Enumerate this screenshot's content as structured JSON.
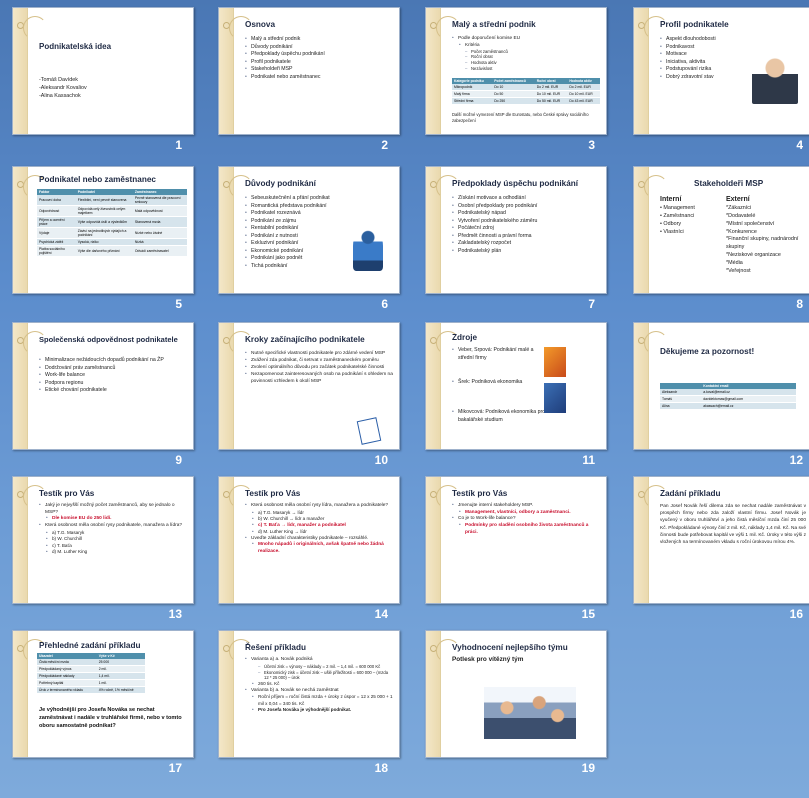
{
  "slides": [
    {
      "num": "1",
      "title": "Podnikatelská idea",
      "authors": [
        "-Tomáš Davídek",
        "-Aleksandr Kovaliov",
        "-Alina Kassachok"
      ]
    },
    {
      "num": "2",
      "title": "Osnova",
      "bullets": [
        "Malý a střední podnik",
        "Důvody podnikání",
        "Předpoklady úspěchu podnikání",
        "Profil podnikatele",
        "Stakeholdeři MSP",
        "Podnikatel nebo zaměstnanec"
      ]
    },
    {
      "num": "3",
      "title": "Malý a střední podnik",
      "bullet1": "Podle doporučení komise EU",
      "sub1": "Kritéria",
      "sub2": [
        "Počet zaměstnanců",
        "Roční obrat",
        "Hodnota aktiv",
        "Nezávislost"
      ],
      "table": {
        "head": [
          "Kategorie podniku",
          "Počet zaměstnanců",
          "Roční obrat",
          "Hodnota aktiv"
        ],
        "rows": [
          [
            "Mikropodnik",
            "Do 10",
            "Do 2 mil. EUR",
            "Do 2 mil. EUR"
          ],
          [
            "Malý firma",
            "Do 50",
            "Do 10 mil. EUR",
            "Do 10 mil. EUR"
          ],
          [
            "Střední firma",
            "Do 250",
            "Do 50 mil. EUR",
            "Do 43 mil. EUR"
          ]
        ]
      },
      "note": "Další možné vymezení MSP dle Eurostatu, nebo České správy sociálního zabezpečení"
    },
    {
      "num": "4",
      "title": "Profil podnikatele",
      "bullets": [
        "Aspekt dlouhodobosti",
        "Podnikavost",
        "Motivace",
        "Iniciativa, aktivita",
        "Podstupování rizika",
        "Dobrý zdravotní stav"
      ]
    },
    {
      "num": "5",
      "title": "Podnikatel nebo zaměstnanec",
      "table": {
        "head": [
          "Faktor",
          "Podnikatel",
          "Zaměstnanec"
        ],
        "rows": [
          [
            "Pracovní doba",
            "Flexibilní, není pevně stanovena",
            "Pevně stanovená dle pracovní smlouvy"
          ],
          [
            "Odpovědnost",
            "Odpovídá celý živnostník celým majetkem",
            "Malá odpovědnost"
          ],
          [
            "Příjem a ocenění práce",
            "Výše odpovídá úsilí a výsledkům",
            "Stanovená mzda"
          ],
          [
            "Výdaje",
            "Závisí na jednotlivých výdajích a podnikání",
            "Nízké nebo žádné"
          ],
          [
            "Psychická zátěž",
            "Vysoká, riziko",
            "Nízká"
          ],
          [
            "Platba sociálního pojištění",
            "Výše dle daňového přiznání",
            "Odvádí zaměstnavatel"
          ]
        ]
      }
    },
    {
      "num": "6",
      "title": "Důvody podnikání",
      "bullets": [
        "Sebeuskutečnění a přání podnikat",
        "Romantická představa podnikání",
        "Podnikatel rozeznává",
        "Podnikání ze zájmu",
        "Rentabilní podnikání",
        "Podnikání z nutnosti",
        "Exkluzivní podnikání",
        "Ekonomické podnikání",
        "Podnikání jako podnět",
        "Tichá podnikání"
      ]
    },
    {
      "num": "7",
      "title": "Předpoklady úspěchu podnikání",
      "bullets": [
        "Získání motivace a odhodlání",
        "Osobní předpoklady pro podnikání",
        "Podnikatelský nápad",
        "Vytvoření podnikatelského záměru",
        "Počáteční zdroj",
        "Předmět činnosti a právní forma",
        "Zakladatelský rozpočet",
        "Podnikatelský plán"
      ]
    },
    {
      "num": "8",
      "title": "Stakeholdeři MSP",
      "internal_h": "Interní",
      "internal": [
        "Management",
        "Zaměstnanci",
        "Odbory",
        "Vlastníci"
      ],
      "external_h": "Externí",
      "external": [
        "Zákazníci",
        "Dodavatelé",
        "Místní společenství",
        "Konkurence",
        "Finanční skupiny, nadnárodní skupiny",
        "Neziskové organizace",
        "Média",
        "Veřejnost"
      ]
    },
    {
      "num": "9",
      "title": "Společenská odpovědnost podnikatele",
      "bullets": [
        "Minimalizace nežádoucích dopadů podnikání na ŽP",
        "Dodržování práv zaměstnanců",
        "Work-life balance",
        "Podpora regionu",
        "Etické chování podnikatele"
      ]
    },
    {
      "num": "10",
      "title": "Kroky začínajícího podnikatele",
      "bullets": [
        "Nutné specifické vlastnosti podnikatele pro zdárné vedení MSP",
        "Zvážení zda podnikat, či setrvat v zaměstnaneckém poměru",
        "Zvolení optimálního důvodu pro začátek podnikatelské činnosti",
        "Nezapomenout zainteresovaných osob na podnikání s ohledem na povinnosti vzhledem k okolí MSP"
      ]
    },
    {
      "num": "11",
      "title": "Zdroje",
      "bullets": [
        "Veber, Srpová: Podnikání malé a střední firmy",
        "Šrek: Podniková ekonomika",
        "Mikovcová: Podniková ekonomika pro bakalářské studium"
      ]
    },
    {
      "num": "12",
      "title": "Děkujeme za pozornost!",
      "table": {
        "head": [
          "",
          "Kontaktní email"
        ],
        "rows": [
          [
            "Aleksandr",
            "a.koval@email.cz"
          ],
          [
            "Tomáš",
            "davidektomas@gmail.com"
          ],
          [
            "Alina",
            "akassach@email.cz"
          ]
        ]
      }
    },
    {
      "num": "13",
      "title": "Testík pro Vás",
      "items": [
        {
          "t": "b",
          "v": "Jaký je nejvyšší možný počet zaměstnanců, aby se jednalo o MSP?"
        },
        {
          "t": "red",
          "v": "Dle komise EU do 250 lidí."
        },
        {
          "t": "b",
          "v": "Která osobnost měla osobní rysy podnikatele, manažera a lídra?"
        },
        {
          "t": "sub",
          "v": "a) T.G. Masaryk"
        },
        {
          "t": "sub",
          "v": "b) W. Churchill"
        },
        {
          "t": "sub",
          "v": "c) T. Baťa"
        },
        {
          "t": "sub",
          "v": "d) M. Luther King"
        }
      ]
    },
    {
      "num": "14",
      "title": "Testík pro Vás",
      "items": [
        {
          "t": "b",
          "v": "Která osobnost měla osobní rysy lídra, manažera a podnikatele?"
        },
        {
          "t": "sub",
          "v": "a) T.G. Masaryk → lídr"
        },
        {
          "t": "sub",
          "v": "b) W. Churchill → lídr a manažer"
        },
        {
          "t": "red",
          "v": "c) T. Baťa → lídr, manažer a podnikatel"
        },
        {
          "t": "sub",
          "v": "d) M. Luther King → lídr"
        },
        {
          "t": "b",
          "v": "Uveďte základní charakteristiky podnikatele – rozsáhlé."
        },
        {
          "t": "red",
          "v": "Mnoho nápadů i originálních, avšak špatně nebo žádná realizace."
        }
      ]
    },
    {
      "num": "15",
      "title": "Testík pro Vás",
      "items": [
        {
          "t": "b",
          "v": "Jmenujte interní stakeholdery MSP."
        },
        {
          "t": "red",
          "v": "Management, vlastníci, odbory a zaměstnanci."
        },
        {
          "t": "b",
          "v": "Co je to Work-life balance?"
        },
        {
          "t": "red",
          "v": "Podmínky pro sladění osobního života zaměstnanců a práci."
        }
      ]
    },
    {
      "num": "16",
      "title": "Zadání příkladu",
      "text": "Pan Josef Novák řeší dilema zda se nechat nadále zaměstnávat v prospěch firmy nebo zda založí vlastní firmu. Josef Novák je vyučený v oboru truhlářství a jeho čistá měsíční mzda činí 25 000 Kč. Předpokládané výnosy činí 2 mil. Kč, náklady 1,4 mil. Kč. Na své činnosti bude potřebovat kapitál ve výši 1 mil. Kč. Úroky v této výši z vložených na termínovaném vkladu s roční úrokovou mírou 4%."
    },
    {
      "num": "17",
      "title": "Přehledné zadání příkladu",
      "table": {
        "head": [
          "Ukazatel",
          "Výše v Kč"
        ],
        "rows": [
          [
            "Čistá měsíční mzda",
            "25 000"
          ],
          [
            "Předpokládaný výnos",
            "2 mil."
          ],
          [
            "Předpokládané náklady",
            "1,4 mil."
          ],
          [
            "Potřebný kapitál",
            "1 mil."
          ],
          [
            "Úrok z termínovaného vkladu",
            "4% ročně, 1% měsíčně"
          ]
        ]
      },
      "question": "Je výhodnější pro Josefa Nováka se nechat zaměstnávat i nadále v truhlářské firmě, nebo v tomto oboru samostatně podnikat?"
    },
    {
      "num": "18",
      "title": "Řešení příkladu",
      "items": [
        {
          "t": "b",
          "v": "Varianta a) a. Novák podniká"
        },
        {
          "t": "sub2",
          "v": "Účetní zisk = výnosy – náklady = 2 mil. – 1,4 mil. = 600 000 Kč"
        },
        {
          "t": "sub2",
          "v": "Ekonomický zisk = účetní zisk – ušlé příležitosti = 600 000 – (mzda 12 * 25 000) – úrok"
        },
        {
          "t": "plain",
          "v": "260 tis. Kč"
        },
        {
          "t": "b",
          "v": "Varianta b) a. Novák se nechá zaměstnat"
        },
        {
          "t": "plain",
          "v": "Roční příjem = roční čistá mzda + úroky z úspor = 12 x 25 000 + 1 mil x 0,04 = 340 tis. Kč"
        },
        {
          "t": "boldline",
          "v": "Pro Josefa Nováka je výhodnější podnikat."
        }
      ]
    },
    {
      "num": "19",
      "title": "Vyhodnocení nejlepšího týmu",
      "subtitle": "Potlesk pro vítězný tým"
    }
  ]
}
